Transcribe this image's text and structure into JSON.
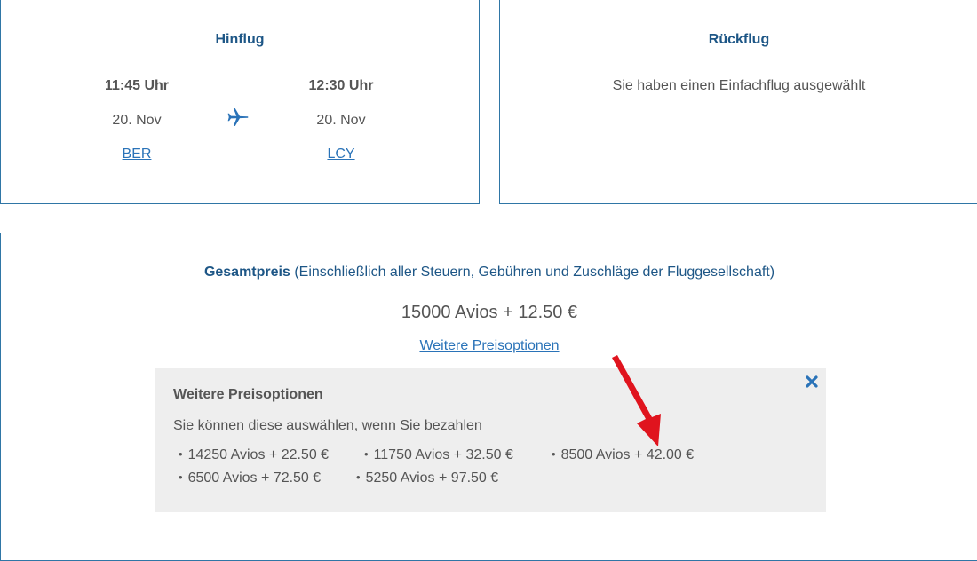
{
  "outbound": {
    "title": "Hinflug",
    "departure": {
      "time": "11:45 Uhr",
      "date": "20. Nov",
      "airport": "BER"
    },
    "arrival": {
      "time": "12:30 Uhr",
      "date": "20. Nov",
      "airport": "LCY"
    },
    "icon": "airplane-icon"
  },
  "return": {
    "title": "Rückflug",
    "message": "Sie haben einen Einfachflug ausgewählt"
  },
  "price": {
    "label": "Gesamtpreis",
    "note": "(Einschließlich aller Steuern, Gebühren und Zuschläge der Fluggesellschaft)",
    "amount": "15000 Avios + 12.50 €",
    "more_link": "Weitere Preisoptionen"
  },
  "options": {
    "title": "Weitere Preisoptionen",
    "subtitle": "Sie können diese auswählen, wenn Sie bezahlen",
    "items": [
      "14250 Avios + 22.50 €",
      "11750 Avios + 32.50 €",
      "8500 Avios + 42.00 €",
      "6500 Avios + 72.50 €",
      "5250 Avios + 97.50 €"
    ],
    "close_icon": "close-icon"
  },
  "colors": {
    "brand_blue": "#1d5686",
    "link_blue": "#2a73b8",
    "border_blue": "#2f76a6",
    "panel_gray": "#eeeeee",
    "annotation_red": "#e0141e"
  }
}
